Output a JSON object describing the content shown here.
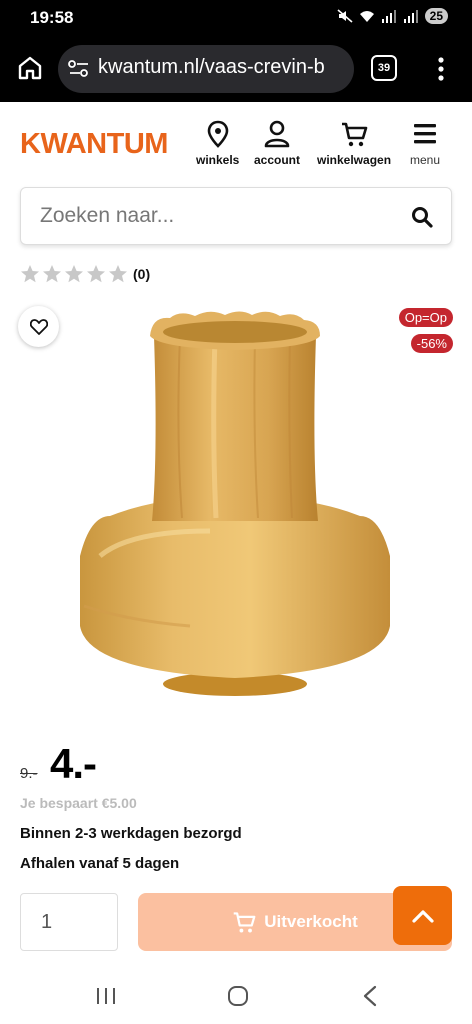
{
  "status_bar": {
    "time": "19:58",
    "battery": "25"
  },
  "browser": {
    "url": "kwantum.nl/vaas-crevin-b",
    "tab_count": "39"
  },
  "header": {
    "logo": "KWANTUM",
    "nav": [
      {
        "label": "winkels",
        "icon": "location-pin-icon"
      },
      {
        "label": "account",
        "icon": "user-icon"
      },
      {
        "label": "winkelwagen",
        "icon": "cart-icon"
      },
      {
        "label": "menu",
        "icon": "hamburger-icon"
      }
    ]
  },
  "search": {
    "placeholder": "Zoeken naar..."
  },
  "product": {
    "rating_count": "(0)",
    "rating_stars": 0,
    "badges": [
      "Op=Op",
      "-56%"
    ],
    "old_price": "9.-",
    "new_price": "4.-",
    "savings": "Je bespaart €5.00",
    "delivery": "Binnen 2-3 werkdagen bezorgd",
    "pickup": "Afhalen vanaf 5 dagen",
    "quantity": "1",
    "buy_label": "Uitverkocht"
  },
  "colors": {
    "brand": "#e8641b",
    "badge": "#c4262e",
    "buy_disabled": "#fbc0a0",
    "scroll_top": "#ee6d0b"
  }
}
